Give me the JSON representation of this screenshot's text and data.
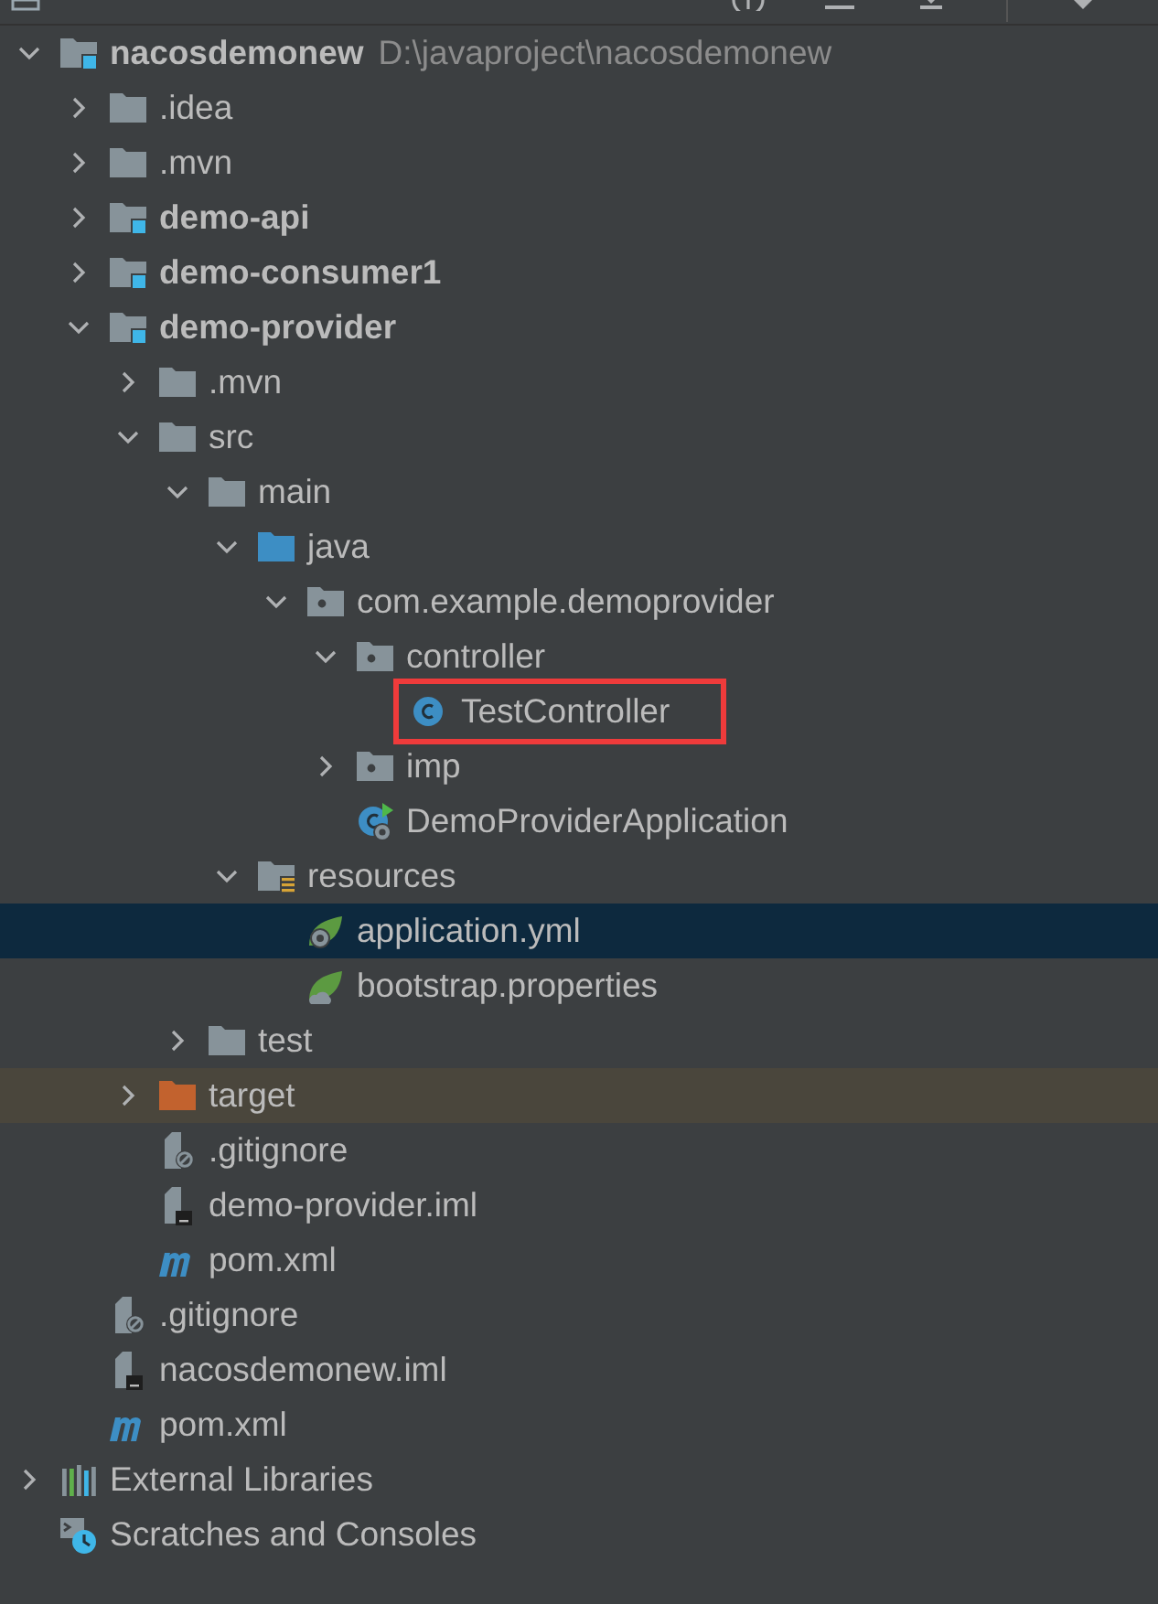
{
  "tree": [
    {
      "label": "nacosdemonew",
      "path": "D:\\javaproject\\nacosdemonew",
      "kind": "module",
      "bold": true,
      "expanded": true,
      "selected": false,
      "boxed": false,
      "children": [
        {
          "label": ".idea",
          "kind": "folder",
          "bold": false,
          "expanded": false,
          "selected": false,
          "boxed": false
        },
        {
          "label": ".mvn",
          "kind": "folder",
          "bold": false,
          "expanded": false,
          "selected": false,
          "boxed": false
        },
        {
          "label": "demo-api",
          "kind": "module",
          "bold": true,
          "expanded": false,
          "selected": false,
          "boxed": false
        },
        {
          "label": "demo-consumer1",
          "kind": "module",
          "bold": true,
          "expanded": false,
          "selected": false,
          "boxed": false
        },
        {
          "label": "demo-provider",
          "kind": "module",
          "bold": true,
          "expanded": true,
          "selected": false,
          "boxed": false,
          "children": [
            {
              "label": ".mvn",
              "kind": "folder",
              "bold": false,
              "expanded": false,
              "selected": false,
              "boxed": false
            },
            {
              "label": "src",
              "kind": "folder",
              "bold": false,
              "expanded": true,
              "selected": false,
              "boxed": false,
              "children": [
                {
                  "label": "main",
                  "kind": "folder",
                  "bold": false,
                  "expanded": true,
                  "selected": false,
                  "boxed": false,
                  "children": [
                    {
                      "label": "java",
                      "kind": "source-folder",
                      "bold": false,
                      "expanded": true,
                      "selected": false,
                      "boxed": false,
                      "children": [
                        {
                          "label": "com.example.demoprovider",
                          "kind": "package",
                          "bold": false,
                          "expanded": true,
                          "selected": false,
                          "boxed": false,
                          "children": [
                            {
                              "label": "controller",
                              "kind": "package",
                              "bold": false,
                              "expanded": true,
                              "selected": false,
                              "boxed": false,
                              "children": [
                                {
                                  "label": "TestController",
                                  "kind": "class",
                                  "bold": false,
                                  "selected": false,
                                  "boxed": true
                                }
                              ]
                            },
                            {
                              "label": "imp",
                              "kind": "package",
                              "bold": false,
                              "expanded": false,
                              "selected": false,
                              "boxed": false
                            },
                            {
                              "label": "DemoProviderApplication",
                              "kind": "boot-class",
                              "bold": false,
                              "selected": false,
                              "boxed": false
                            }
                          ]
                        }
                      ]
                    },
                    {
                      "label": "resources",
                      "kind": "resources-folder",
                      "bold": false,
                      "expanded": true,
                      "selected": false,
                      "boxed": false,
                      "children": [
                        {
                          "label": "application.yml",
                          "kind": "spring-config",
                          "bold": false,
                          "selected": true,
                          "boxed": false
                        },
                        {
                          "label": "bootstrap.properties",
                          "kind": "spring-properties",
                          "bold": false,
                          "selected": false,
                          "boxed": false
                        }
                      ]
                    }
                  ]
                },
                {
                  "label": "test",
                  "kind": "folder",
                  "bold": false,
                  "expanded": false,
                  "selected": false,
                  "boxed": false
                }
              ]
            },
            {
              "label": "target",
              "kind": "excluded-folder",
              "bold": false,
              "expanded": false,
              "selected": false,
              "boxed": false
            },
            {
              "label": ".gitignore",
              "kind": "ignore-file",
              "bold": false,
              "selected": false,
              "boxed": false
            },
            {
              "label": "demo-provider.iml",
              "kind": "iml-file",
              "bold": false,
              "selected": false,
              "boxed": false
            },
            {
              "label": "pom.xml",
              "kind": "maven",
              "bold": false,
              "selected": false,
              "boxed": false
            }
          ]
        },
        {
          "label": ".gitignore",
          "kind": "ignore-file",
          "bold": false,
          "selected": false,
          "boxed": false
        },
        {
          "label": "nacosdemonew.iml",
          "kind": "iml-file",
          "bold": false,
          "selected": false,
          "boxed": false
        },
        {
          "label": "pom.xml",
          "kind": "maven",
          "bold": false,
          "selected": false,
          "boxed": false
        }
      ]
    },
    {
      "label": "External Libraries",
      "kind": "libraries",
      "bold": false,
      "expanded": false,
      "selected": false,
      "boxed": false
    },
    {
      "label": "Scratches and Consoles",
      "kind": "scratches",
      "bold": false,
      "selected": false,
      "boxed": false
    }
  ]
}
